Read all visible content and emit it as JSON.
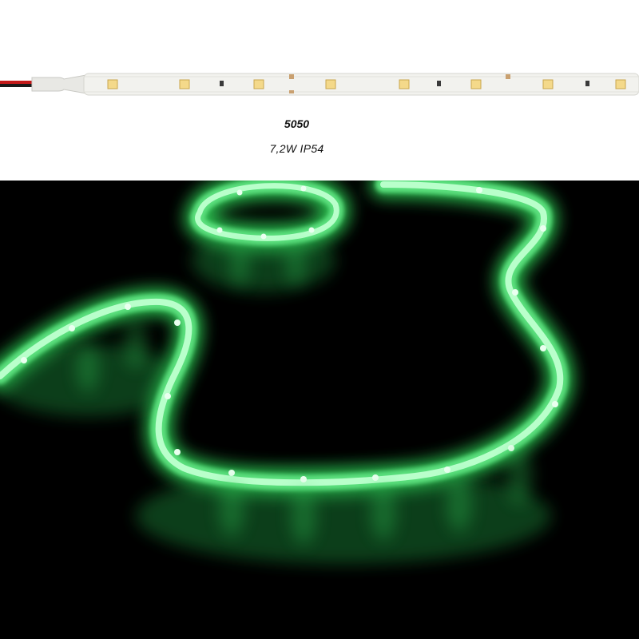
{
  "product": {
    "model": "5050",
    "spec": "7,2W  IP54",
    "strip_color": "#f2f2ee",
    "led_color": "#f4d98a",
    "glow_color": "#4dff7a",
    "wire_colors": [
      "#c41a1a",
      "#1a1a1a"
    ]
  }
}
